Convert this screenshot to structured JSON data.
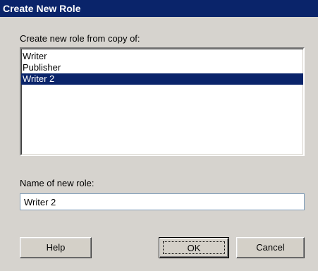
{
  "window": {
    "title": "Create New Role"
  },
  "copy_from": {
    "label": "Create new role from copy of:",
    "items": [
      {
        "label": "Writer",
        "selected": false
      },
      {
        "label": "Publisher",
        "selected": false
      },
      {
        "label": "Writer 2",
        "selected": true
      }
    ]
  },
  "name_field": {
    "label": "Name of new role:",
    "value": "Writer 2"
  },
  "buttons": {
    "help": "Help",
    "ok": "OK",
    "cancel": "Cancel"
  }
}
